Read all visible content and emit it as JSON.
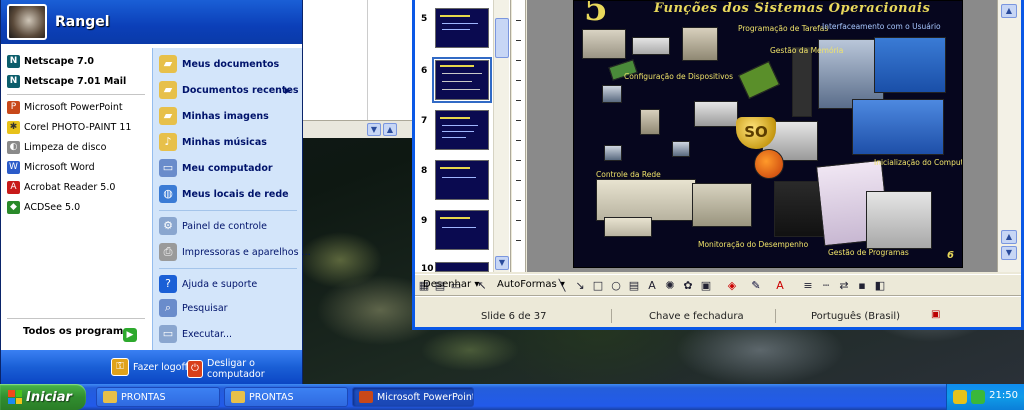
{
  "start_menu": {
    "username": "Rangel",
    "pinned": [
      {
        "label": "Netscape 7.0",
        "icon": "netscape-icon",
        "bold": true
      },
      {
        "label": "Netscape 7.01 Mail",
        "icon": "netscape-mail-icon",
        "bold": true
      }
    ],
    "recent": [
      {
        "label": "Microsoft PowerPoint",
        "icon": "powerpoint-icon"
      },
      {
        "label": "Corel PHOTO-PAINT 11",
        "icon": "photopaint-icon"
      },
      {
        "label": "Limpeza de disco",
        "icon": "disk-cleanup-icon"
      },
      {
        "label": "Microsoft Word",
        "icon": "word-icon"
      },
      {
        "label": "Acrobat Reader 5.0",
        "icon": "acrobat-icon"
      },
      {
        "label": "ACDSee 5.0",
        "icon": "acdsee-icon"
      }
    ],
    "all_programs": "Todos os programas",
    "places": [
      {
        "label": "Meus documentos",
        "icon": "folder-icon"
      },
      {
        "label": "Documentos recentes",
        "icon": "recent-documents-icon",
        "has_submenu": true
      },
      {
        "label": "Minhas imagens",
        "icon": "folder-pictures-icon"
      },
      {
        "label": "Minhas músicas",
        "icon": "folder-music-icon"
      },
      {
        "label": "Meu computador",
        "icon": "computer-icon"
      },
      {
        "label": "Meus locais de rede",
        "icon": "network-icon"
      }
    ],
    "system": [
      {
        "label": "Painel de controle",
        "icon": "control-panel-icon"
      },
      {
        "label": "Impressoras e aparelhos ...",
        "icon": "printer-icon"
      }
    ],
    "help": [
      {
        "label": "Ajuda e suporte",
        "icon": "help-icon"
      },
      {
        "label": "Pesquisar",
        "icon": "search-icon"
      },
      {
        "label": "Executar...",
        "icon": "run-icon"
      }
    ],
    "footer": {
      "logoff": "Fazer logoff",
      "shutdown": "Desligar o computador"
    }
  },
  "powerpoint": {
    "slide_numbers": [
      "5",
      "6",
      "7",
      "8",
      "9",
      "10"
    ],
    "selected_slide": "6",
    "slide": {
      "number": "5",
      "title": "Funções dos Sistemas Operacionais",
      "labels": [
        "Programação de Tarefas",
        "Interfaceamento com o Usuário",
        "Gestão da Memória",
        "Configuração de Dispositivos",
        "Controle da Rede",
        "SO",
        "Monitoração do Desempenho",
        "Gestão de Programas",
        "Inicialização do Computador"
      ],
      "page": "6"
    },
    "drawing_toolbar": {
      "draw": "Desenhar",
      "autoshapes": "AutoFormas"
    },
    "status": {
      "slide": "Slide 6 de 37",
      "design": "Chave e fechadura",
      "language": "Português (Brasil)"
    }
  },
  "taskbar": {
    "start": "Iniciar",
    "buttons": [
      {
        "label": "PRONTAS",
        "icon": "folder-icon",
        "active": false
      },
      {
        "label": "PRONTAS",
        "icon": "folder-icon",
        "active": false
      },
      {
        "label": "Microsoft PowerPoint ...",
        "icon": "powerpoint-icon",
        "active": true
      }
    ],
    "clock": "21:50"
  }
}
